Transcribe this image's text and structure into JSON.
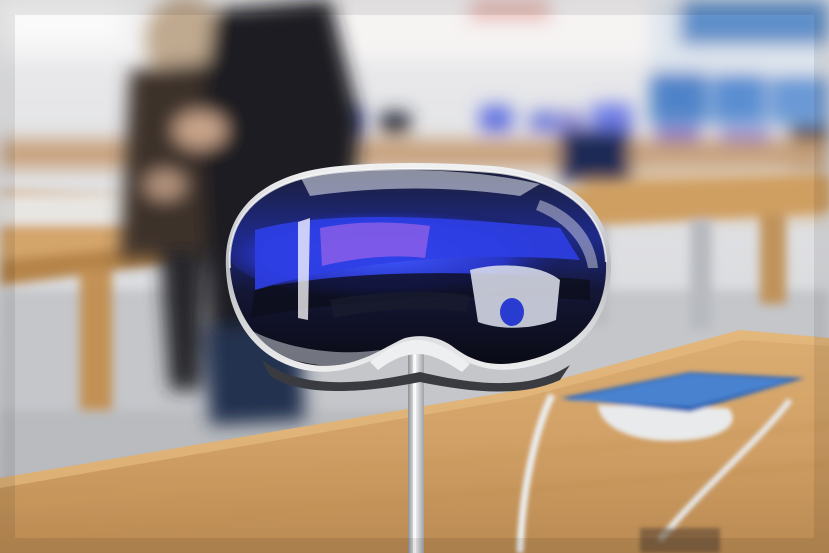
{
  "scene": {
    "subject": "headset-on-display-stand",
    "palette": {
      "wall": "#e4e4e6",
      "floor": "#c9cbcf",
      "wood_light": "#d6a86e",
      "wood_mid": "#c99a5e",
      "wood_dark": "#a87a44",
      "glass_dark": "#0d1022",
      "glass_blue": "#2b3fd8",
      "glass_violet": "#7b4fe0",
      "frame_silver": "#d9dadc",
      "cushion": "#3a3b40",
      "tablet_screen": "#3d78c8",
      "person_dark": "#1d1e22",
      "person_coat": "#3b3430"
    }
  }
}
